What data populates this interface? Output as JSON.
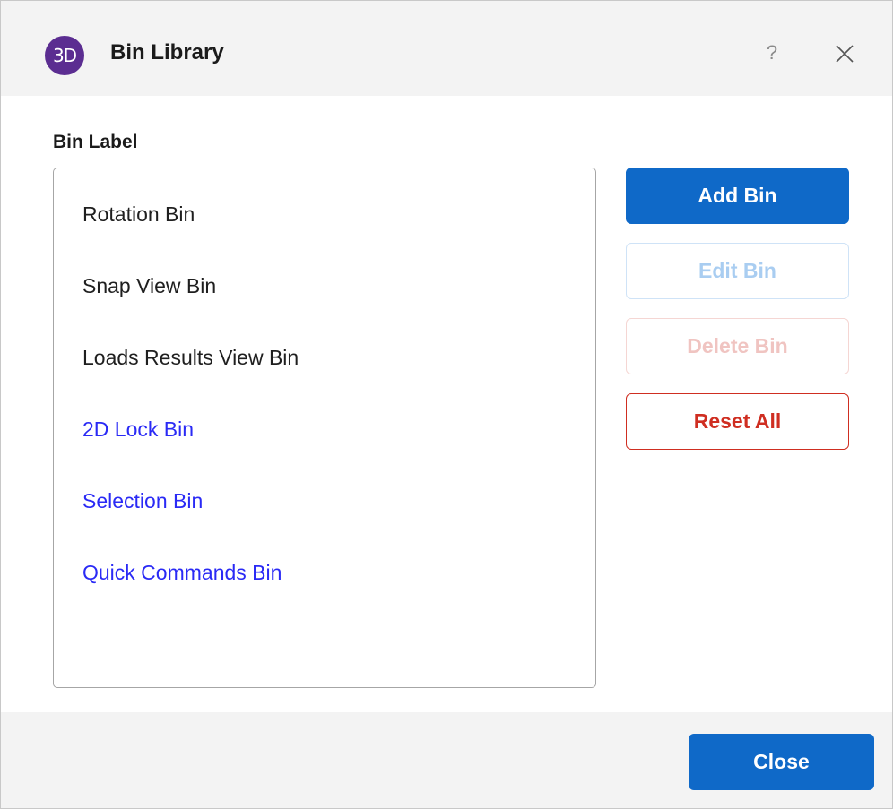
{
  "window": {
    "app_icon_text": "3D",
    "title": "Bin Library",
    "help_label": "?",
    "accent_color": "#0f69c8",
    "app_icon_color": "#5b2d91"
  },
  "section_label": "Bin Label",
  "bins": [
    {
      "label": "Rotation Bin",
      "kind": "default"
    },
    {
      "label": "Snap View Bin",
      "kind": "default"
    },
    {
      "label": "Loads Results View Bin",
      "kind": "default"
    },
    {
      "label": "2D Lock Bin",
      "kind": "custom"
    },
    {
      "label": "Selection Bin",
      "kind": "custom"
    },
    {
      "label": "Quick Commands Bin",
      "kind": "custom"
    }
  ],
  "actions": {
    "add_label": "Add Bin",
    "edit_label": "Edit Bin",
    "edit_enabled": false,
    "delete_label": "Delete Bin",
    "delete_enabled": false,
    "reset_label": "Reset All"
  },
  "footer": {
    "close_label": "Close"
  },
  "icons": {
    "app": "app-logo-icon",
    "help": "help-icon",
    "close": "close-icon"
  }
}
